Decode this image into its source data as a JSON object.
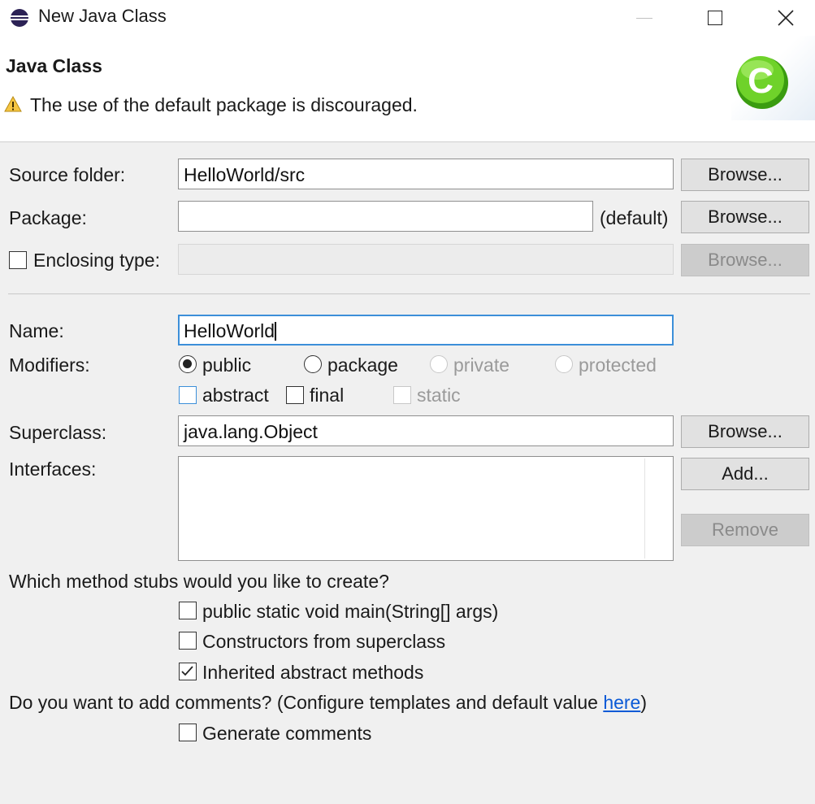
{
  "window": {
    "title": "New Java Class",
    "controls": [
      "minimize",
      "maximize",
      "close"
    ]
  },
  "header": {
    "title": "Java Class",
    "warning": "The use of the default package is discouraged."
  },
  "source_folder": {
    "label": "Source folder:",
    "value": "HelloWorld/src",
    "browse": "Browse..."
  },
  "package": {
    "label": "Package:",
    "value": "",
    "suffix": "(default)",
    "browse": "Browse..."
  },
  "enclosing": {
    "label": "Enclosing type:",
    "checked": false,
    "value": "",
    "browse": "Browse..."
  },
  "name": {
    "label": "Name:",
    "value": "HelloWorld"
  },
  "modifiers": {
    "label": "Modifiers:",
    "access": [
      {
        "label": "public",
        "selected": true,
        "enabled": true
      },
      {
        "label": "package",
        "selected": false,
        "enabled": true
      },
      {
        "label": "private",
        "selected": false,
        "enabled": false
      },
      {
        "label": "protected",
        "selected": false,
        "enabled": false
      }
    ],
    "flags": [
      {
        "label": "abstract",
        "checked": false,
        "enabled": true
      },
      {
        "label": "final",
        "checked": false,
        "enabled": true
      },
      {
        "label": "static",
        "checked": false,
        "enabled": false
      }
    ]
  },
  "superclass": {
    "label": "Superclass:",
    "value": "java.lang.Object",
    "browse": "Browse..."
  },
  "interfaces": {
    "label": "Interfaces:",
    "add": "Add...",
    "remove": "Remove"
  },
  "stubs": {
    "question": "Which method stubs would you like to create?",
    "options": [
      {
        "label": "public static void main(String[] args)",
        "checked": false
      },
      {
        "label": "Constructors from superclass",
        "checked": false
      },
      {
        "label": "Inherited abstract methods",
        "checked": true
      }
    ]
  },
  "comments": {
    "question_prefix": "Do you want to add comments? (Configure templates and default value ",
    "link": "here",
    "question_suffix": ")",
    "option": {
      "label": "Generate comments",
      "checked": false
    }
  },
  "colors": {
    "accent": "#3c8fd9",
    "link": "#0b5ad6",
    "class_icon": "#5ec21c"
  }
}
